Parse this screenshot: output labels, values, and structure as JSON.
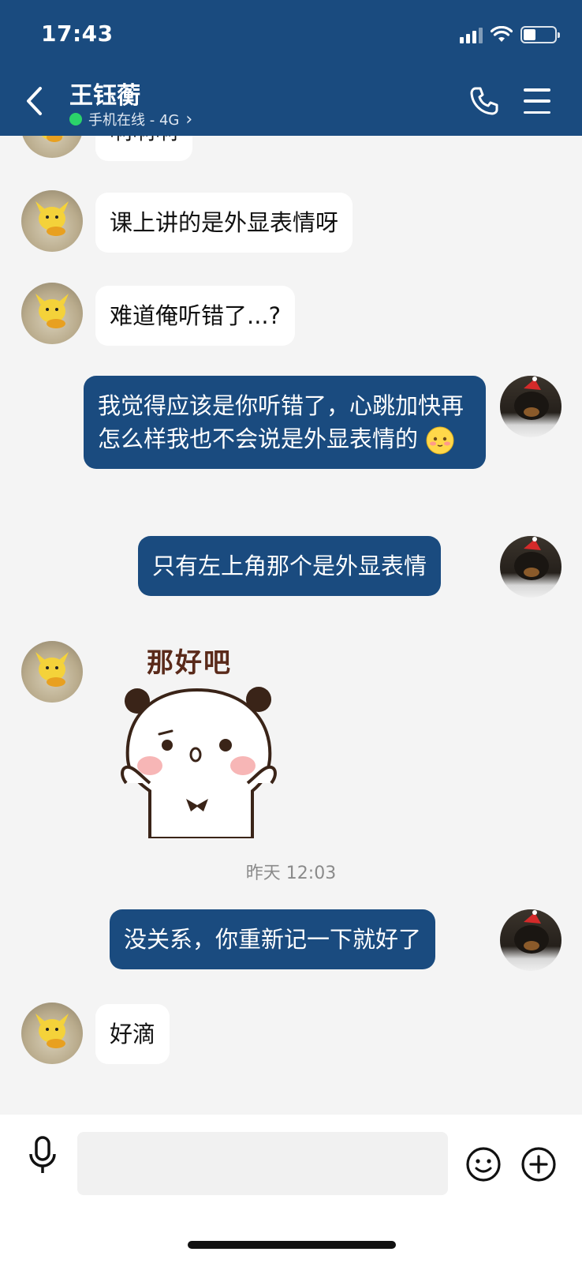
{
  "status_bar": {
    "time": "17:43"
  },
  "header": {
    "contact_name": "王钰蘅",
    "contact_status": "手机在线 - 4G",
    "status_chevron": "›"
  },
  "messages": [
    {
      "side": "in",
      "text": "啊啊啊"
    },
    {
      "side": "in",
      "text": "课上讲的是外显表情呀"
    },
    {
      "side": "in",
      "text": "难道俺听错了...?"
    },
    {
      "side": "out",
      "text": "我觉得应该是你听错了，心跳加快再怎么样我也不会说是外显表情的",
      "emoji": "blushing-face"
    },
    {
      "side": "out",
      "text": "只有左上角那个是外显表情"
    },
    {
      "side": "in",
      "type": "sticker",
      "sticker_text": "那好吧",
      "sticker_name": "panda-sticker"
    },
    {
      "type": "timestamp",
      "text": "昨天 12:03"
    },
    {
      "side": "out",
      "text": "没关系，你重新记一下就好了"
    },
    {
      "side": "in",
      "text": "好滴"
    }
  ],
  "input_bar": {
    "placeholder": "",
    "icons": [
      "microphone-icon",
      "emoji-icon",
      "plus-icon"
    ]
  },
  "colors": {
    "header_bg": "#1a4b7f",
    "outgoing_bubble": "#1a4b7f",
    "incoming_bubble": "#ffffff",
    "chat_bg": "#f4f4f4",
    "online_dot": "#2bd36a"
  }
}
